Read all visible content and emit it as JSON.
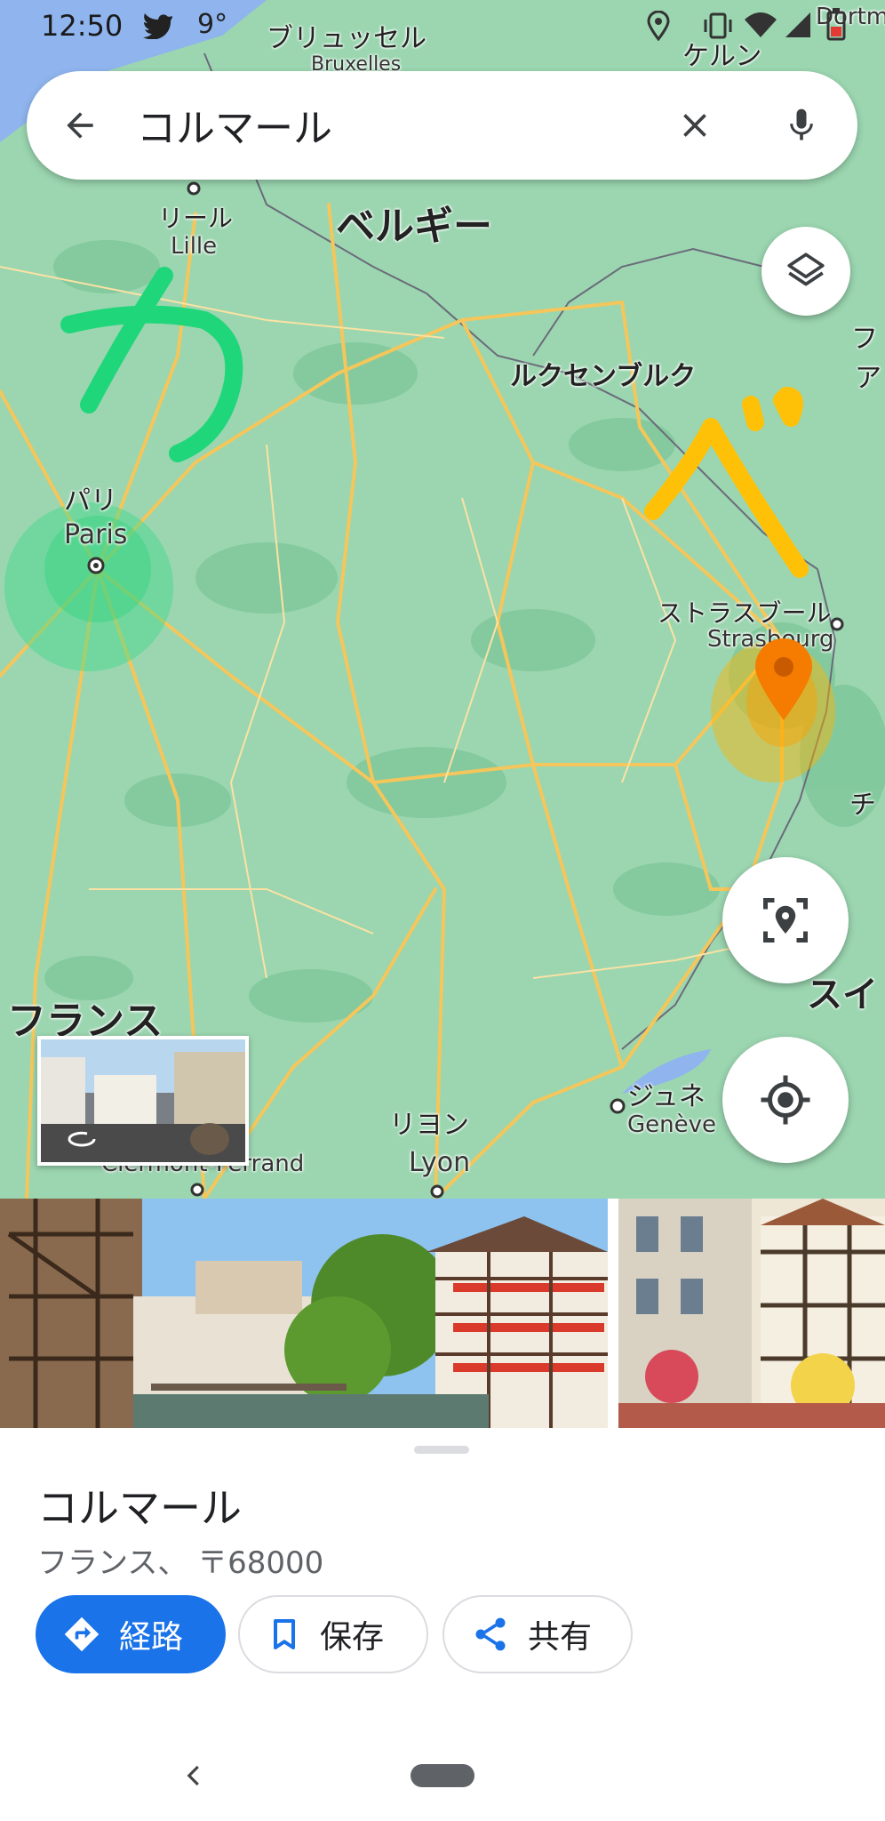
{
  "status_bar": {
    "time": "12:50",
    "temperature": "9°",
    "icons": [
      "twitter-icon",
      "location-icon",
      "vibrate-icon",
      "wifi-icon",
      "signal-icon",
      "battery-icon"
    ]
  },
  "search": {
    "query": "コルマール",
    "back_icon": "arrow-back-icon",
    "clear_icon": "close-icon",
    "voice_icon": "mic-icon"
  },
  "map": {
    "countries": [
      {
        "name": "ベルギー"
      },
      {
        "name": "ルクセンブルク"
      },
      {
        "name": "フランス"
      }
    ],
    "cities": [
      {
        "jp": "ブリュッセル",
        "latin": "Bruxelles"
      },
      {
        "jp": "ケルン",
        "latin": ""
      },
      {
        "jp": "",
        "latin": "Dortm"
      },
      {
        "jp": "リール",
        "latin": "Lille"
      },
      {
        "jp": "パリ",
        "latin": "Paris"
      },
      {
        "jp": "ストラスブール",
        "latin": "Strasbourg"
      },
      {
        "jp": "リヨン",
        "latin": "Lyon"
      },
      {
        "jp": "ジュネ",
        "latin": "Genève"
      },
      {
        "jp": "",
        "latin": "Clermont-Ferrand"
      },
      {
        "jp": "スイ",
        "latin": ""
      },
      {
        "jp": "チ",
        "latin": ""
      },
      {
        "jp": "フ",
        "latin": ""
      },
      {
        "jp": "ア",
        "latin": ""
      }
    ],
    "handwriting": [
      {
        "text": "カ",
        "color": "#1fd67a"
      },
      {
        "text": "べ",
        "color": "#ffc107"
      }
    ],
    "pin_color": "#f57c00"
  },
  "controls": {
    "layers_icon": "layers-icon",
    "location_frame_icon": "location-frame-icon",
    "my_location_icon": "my-location-icon",
    "street_view_icon": "street-view-360-icon"
  },
  "place": {
    "title": "コルマール",
    "address": "フランス、 〒68000"
  },
  "actions": [
    {
      "label": "経路",
      "icon": "directions-icon"
    },
    {
      "label": "保存",
      "icon": "bookmark-icon"
    },
    {
      "label": "共有",
      "icon": "share-icon"
    }
  ],
  "colors": {
    "accent": "#1a73e8",
    "map_bg": "#9bd6b0",
    "road": "#f4c65b"
  },
  "nav": {
    "back_icon": "nav-back-icon",
    "home_icon": "home-pill-icon"
  }
}
